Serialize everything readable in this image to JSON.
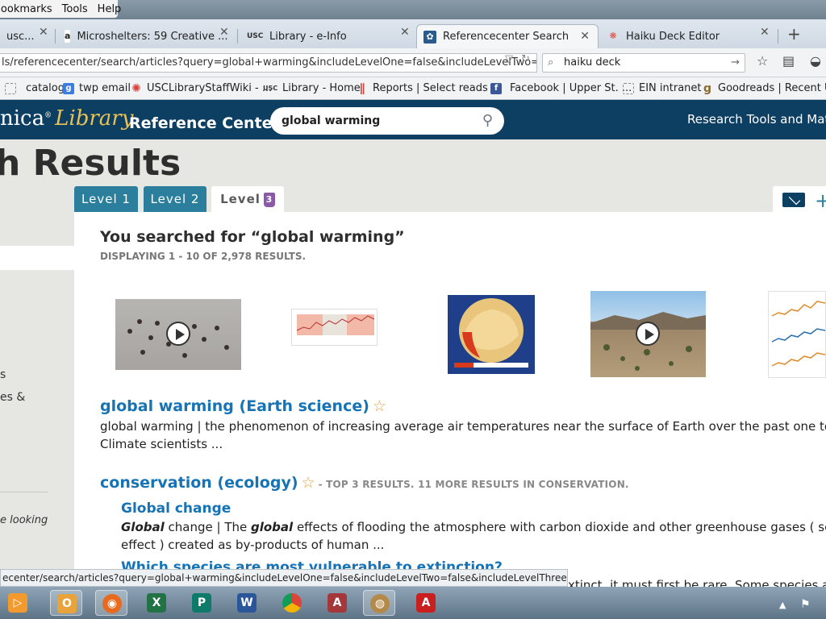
{
  "menu": {
    "items": [
      "Bookmarks",
      "Tools",
      "Help"
    ]
  },
  "tabs": [
    {
      "label": "usc...",
      "icon": "page-icon"
    },
    {
      "label": "Microshelters: 59 Creative ...",
      "icon": "amazon-icon"
    },
    {
      "label": "Library - e-Info",
      "icon": "usc-icon"
    },
    {
      "label": "Referencecenter Search",
      "icon": "thistle-icon",
      "active": true
    },
    {
      "label": "Haiku Deck Editor",
      "icon": "haiku-icon"
    }
  ],
  "toolbar": {
    "url": "ls/referencecenter/search/articles?query=global+warming&includeLevelOne=false&includeLevelTwo=false&in",
    "search_value": "haiku deck"
  },
  "bookmarks": [
    {
      "label": "catalog"
    },
    {
      "label": "twp email"
    },
    {
      "label": "USCLibraryStaffWiki - ..."
    },
    {
      "label": "Library - Home"
    },
    {
      "label": "Reports | Select reads ..."
    },
    {
      "label": "Facebook | Upper St. ..."
    },
    {
      "label": "EIN intranet"
    },
    {
      "label": "Goodreads | Recent U..."
    }
  ],
  "site": {
    "brand": "nica",
    "brand_italic": "Library",
    "section": "Reference Center",
    "search_value": "global warming",
    "nav_right": "Research Tools and Mate"
  },
  "page": {
    "title": "h Results",
    "levels": [
      "Level 1",
      "Level 2",
      "Level"
    ],
    "level_badge": "3",
    "searched_for": "You searched for “global warming”",
    "displaying": "DISPLAYING 1 - 10 OF 2,978 RESULTS."
  },
  "sidebar": {
    "items": [
      "s",
      "es &",
      "e looking"
    ]
  },
  "results": [
    {
      "title": "global warming (Earth science)",
      "text_line1": "global warming   |   the phenomenon of increasing average air temperatures  near the surface of Earth  over the past one to two c",
      "text_line2": "Climate scientists ..."
    },
    {
      "title": "conservation (ecology)",
      "note": "- TOP 3 RESULTS. 11 MORE RESULTS IN CONSERVATION.",
      "children": [
        {
          "title": "Global change",
          "text_line1_bold1": "Global",
          "text_line1_mid": " change  | The ",
          "text_line1_bold2": "global",
          "text_line1_rest": " effects of flooding the atmosphere with carbon dioxide and other greenhouse gases ( see  greenh",
          "text_line2": "effect ) created as by-products of human ..."
        },
        {
          "title": "Which species are most vulnerable to extinction?",
          "text_tail": "xtinct, it must first be rare. Some species are n"
        }
      ]
    }
  ],
  "statusbar": {
    "text": "ecenter/search/articles?query=global+warming&includeLevelOne=false&includeLevelTwo=false&includeLevelThree=false#"
  }
}
